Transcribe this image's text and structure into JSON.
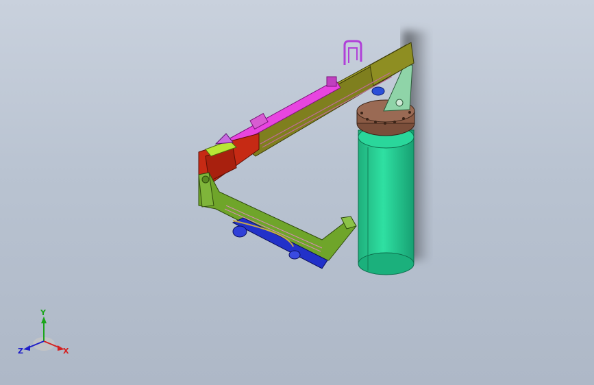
{
  "viewport": {
    "background_top": "#c9d1dd",
    "background_bottom": "#aeb8c7"
  },
  "model": {
    "parts": [
      {
        "name": "column",
        "color": "#22cc8f"
      },
      {
        "name": "flange",
        "color": "#8a5a44"
      },
      {
        "name": "upper-boom",
        "color": "#7a7a1c"
      },
      {
        "name": "lower-boom",
        "color": "#6fa52a"
      },
      {
        "name": "hydraulic-cylinder-upper",
        "color": "#e23be0"
      },
      {
        "name": "hydraulic-cylinder-lower",
        "color": "#2230c8"
      },
      {
        "name": "elbow-joint",
        "color": "#d22c14"
      },
      {
        "name": "hand-rail",
        "color": "#b040d8"
      },
      {
        "name": "support-bracket",
        "color": "#7fd09a"
      }
    ]
  },
  "triad": {
    "y_label": "Y",
    "x_label": "X",
    "z_label": "Z",
    "y_color": "#1aa51a",
    "x_color": "#d42020",
    "z_color": "#2020c8"
  }
}
